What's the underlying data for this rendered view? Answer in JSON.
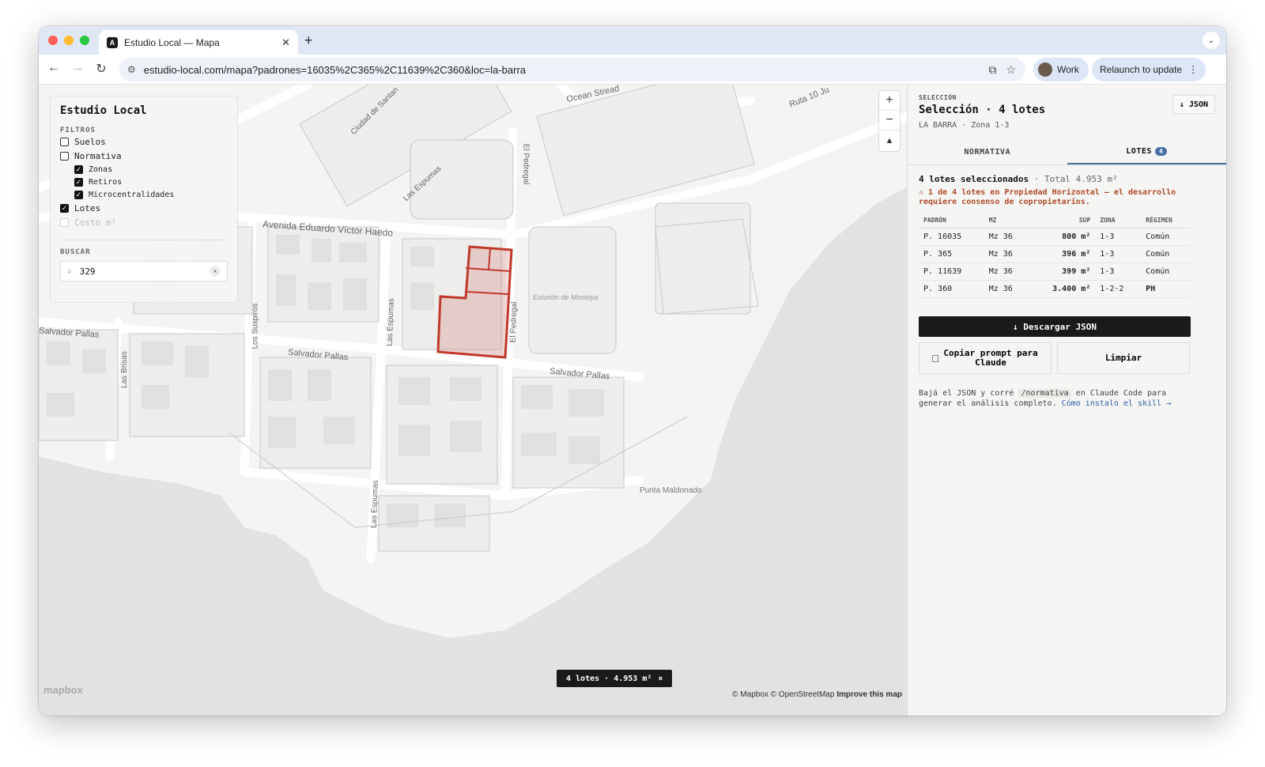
{
  "browser": {
    "tab_title": "Estudio Local — Mapa",
    "tab_favicon": "A",
    "url": "estudio-local.com/mapa?padrones=16035%2C365%2C11639%2C360&loc=la-barra",
    "profile_label": "Work",
    "relaunch_label": "Relaunch to update"
  },
  "filters": {
    "title": "Estudio Local",
    "section_label": "FILTROS",
    "items": [
      {
        "label": "Suelos",
        "checked": false
      },
      {
        "label": "Normativa",
        "checked": false
      },
      {
        "label": "Zonas",
        "checked": true,
        "sub": true
      },
      {
        "label": "Retiros",
        "checked": true,
        "sub": true
      },
      {
        "label": "Microcentralidades",
        "checked": true,
        "sub": true
      },
      {
        "label": "Lotes",
        "checked": true
      },
      {
        "label": "Costo m²",
        "checked": false,
        "disabled": true
      }
    ],
    "search_label": "BUSCAR",
    "search_value": "329"
  },
  "map": {
    "streets": [
      "Ocean Stread",
      "Ruta 10 Ju",
      "Ciudad de Santan",
      "Las Espumas",
      "El Pedregal",
      "Avenida Eduardo Víctor Haedo",
      "Los Suspiros",
      "Salvador Pallas",
      "Las Brisas",
      "Salvador Pallas",
      "Salvador Pallas",
      "El Pedregal",
      "Las Espumas",
      "Las Espumas"
    ],
    "place_labels": [
      "Esturión de Montoya",
      "Punta Maldonado"
    ],
    "selection_badge": "4 lotes · 4.953 m²",
    "selection_badge_close": "×",
    "mapbox_logo": "mapbox",
    "attribution": "© Mapbox © OpenStreetMap",
    "attribution_link": "Improve this map",
    "highlight_color": "#c0392b"
  },
  "panel": {
    "eyebrow": "SELECCIÓN",
    "title": "Selección · 4 lotes",
    "subtitle": "LA BARRA · Zona 1-3",
    "json_button": "↓ JSON",
    "tabs": [
      {
        "label": "NORMATIVA"
      },
      {
        "label": "LOTES",
        "count": "4"
      }
    ],
    "summary_bold": "4 lotes seleccionados",
    "summary_rest": " · Total 4.953 m²",
    "warning": "⚠ 1 de 4 lotes en Propiedad Horizontal — el desarrollo requiere consenso de copropietarios.",
    "table": {
      "headers": [
        "PADRÓN",
        "MZ",
        "SUP",
        "ZONA",
        "RÉGIMEN"
      ],
      "rows": [
        {
          "padron": "P. 16035",
          "mz": "Mz 36",
          "sup": "800 m²",
          "zona": "1-3",
          "regimen": "Común"
        },
        {
          "padron": "P. 365",
          "mz": "Mz 36",
          "sup": "396 m²",
          "zona": "1-3",
          "regimen": "Común"
        },
        {
          "padron": "P. 11639",
          "mz": "Mz 36",
          "sup": "399 m²",
          "zona": "1-3",
          "regimen": "Común"
        },
        {
          "padron": "P. 360",
          "mz": "Mz 36",
          "sup": "3.400 m²",
          "zona": "1-2-2",
          "regimen": "PH"
        }
      ]
    },
    "download_button": "↓ Descargar JSON",
    "copy_button": "Copiar prompt para Claude",
    "clear_button": "Limpiar",
    "hint_prefix": "Bajá el JSON y corré ",
    "hint_code": "/normativa",
    "hint_middle": " en Claude Code para generar el análisis completo. ",
    "hint_link": "Cómo instalo el skill →"
  }
}
